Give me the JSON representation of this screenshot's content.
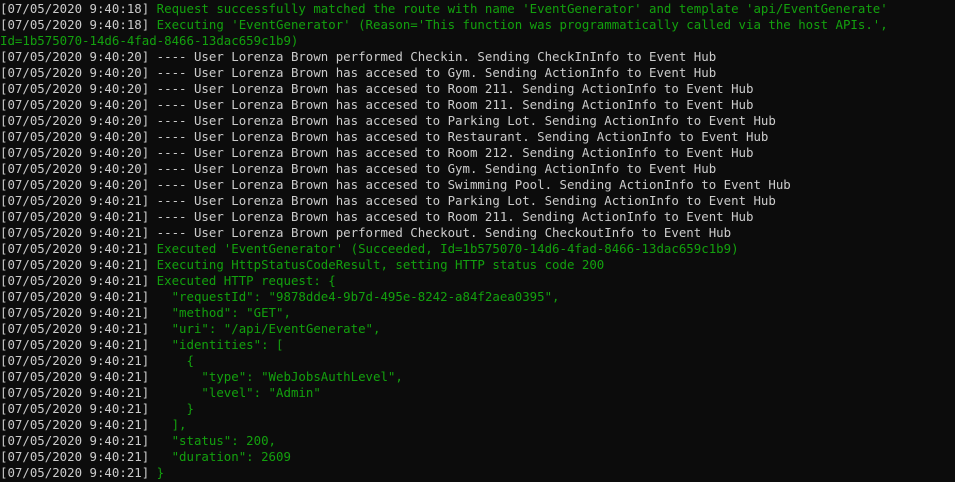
{
  "colors": {
    "background": "#0c0c0c",
    "timestamp": "#cccccc",
    "green": "#13a10e",
    "gray": "#cccccc"
  },
  "lines": [
    {
      "ts": "[07/05/2020 9:40:18]",
      "msg": " Request successfully matched the route with name 'EventGenerator' and template 'api/EventGenerate'",
      "c": "green"
    },
    {
      "ts": "[07/05/2020 9:40:18]",
      "msg": " Executing 'EventGenerator' (Reason='This function was programmatically called via the host APIs.',",
      "c": "green"
    },
    {
      "ts": "",
      "msg": "Id=1b575070-14d6-4fad-8466-13dac659c1b9)",
      "c": "green"
    },
    {
      "ts": "[07/05/2020 9:40:20]",
      "msg": " ---- User Lorenza Brown performed Checkin. Sending CheckInInfo to Event Hub",
      "c": "gray"
    },
    {
      "ts": "[07/05/2020 9:40:20]",
      "msg": " ---- User Lorenza Brown has accesed to Gym. Sending ActionInfo to Event Hub",
      "c": "gray"
    },
    {
      "ts": "[07/05/2020 9:40:20]",
      "msg": " ---- User Lorenza Brown has accesed to Room 211. Sending ActionInfo to Event Hub",
      "c": "gray"
    },
    {
      "ts": "[07/05/2020 9:40:20]",
      "msg": " ---- User Lorenza Brown has accesed to Room 211. Sending ActionInfo to Event Hub",
      "c": "gray"
    },
    {
      "ts": "[07/05/2020 9:40:20]",
      "msg": " ---- User Lorenza Brown has accesed to Parking Lot. Sending ActionInfo to Event Hub",
      "c": "gray"
    },
    {
      "ts": "[07/05/2020 9:40:20]",
      "msg": " ---- User Lorenza Brown has accesed to Restaurant. Sending ActionInfo to Event Hub",
      "c": "gray"
    },
    {
      "ts": "[07/05/2020 9:40:20]",
      "msg": " ---- User Lorenza Brown has accesed to Room 212. Sending ActionInfo to Event Hub",
      "c": "gray"
    },
    {
      "ts": "[07/05/2020 9:40:20]",
      "msg": " ---- User Lorenza Brown has accesed to Gym. Sending ActionInfo to Event Hub",
      "c": "gray"
    },
    {
      "ts": "[07/05/2020 9:40:20]",
      "msg": " ---- User Lorenza Brown has accesed to Swimming Pool. Sending ActionInfo to Event Hub",
      "c": "gray"
    },
    {
      "ts": "[07/05/2020 9:40:21]",
      "msg": " ---- User Lorenza Brown has accesed to Parking Lot. Sending ActionInfo to Event Hub",
      "c": "gray"
    },
    {
      "ts": "[07/05/2020 9:40:21]",
      "msg": " ---- User Lorenza Brown has accesed to Room 211. Sending ActionInfo to Event Hub",
      "c": "gray"
    },
    {
      "ts": "[07/05/2020 9:40:21]",
      "msg": " ---- User Lorenza Brown performed Checkout. Sending CheckoutInfo to Event Hub",
      "c": "gray"
    },
    {
      "ts": "[07/05/2020 9:40:21]",
      "msg": " Executed 'EventGenerator' (Succeeded, Id=1b575070-14d6-4fad-8466-13dac659c1b9)",
      "c": "green"
    },
    {
      "ts": "[07/05/2020 9:40:21]",
      "msg": " Executing HttpStatusCodeResult, setting HTTP status code 200",
      "c": "green"
    },
    {
      "ts": "[07/05/2020 9:40:21]",
      "msg": " Executed HTTP request: {",
      "c": "green"
    },
    {
      "ts": "[07/05/2020 9:40:21]",
      "msg": "   \"requestId\": \"9878dde4-9b7d-495e-8242-a84f2aea0395\",",
      "c": "green"
    },
    {
      "ts": "[07/05/2020 9:40:21]",
      "msg": "   \"method\": \"GET\",",
      "c": "green"
    },
    {
      "ts": "[07/05/2020 9:40:21]",
      "msg": "   \"uri\": \"/api/EventGenerate\",",
      "c": "green"
    },
    {
      "ts": "[07/05/2020 9:40:21]",
      "msg": "   \"identities\": [",
      "c": "green"
    },
    {
      "ts": "[07/05/2020 9:40:21]",
      "msg": "     {",
      "c": "green"
    },
    {
      "ts": "[07/05/2020 9:40:21]",
      "msg": "       \"type\": \"WebJobsAuthLevel\",",
      "c": "green"
    },
    {
      "ts": "[07/05/2020 9:40:21]",
      "msg": "       \"level\": \"Admin\"",
      "c": "green"
    },
    {
      "ts": "[07/05/2020 9:40:21]",
      "msg": "     }",
      "c": "green"
    },
    {
      "ts": "[07/05/2020 9:40:21]",
      "msg": "   ],",
      "c": "green"
    },
    {
      "ts": "[07/05/2020 9:40:21]",
      "msg": "   \"status\": 200,",
      "c": "green"
    },
    {
      "ts": "[07/05/2020 9:40:21]",
      "msg": "   \"duration\": 2609",
      "c": "green"
    },
    {
      "ts": "[07/05/2020 9:40:21]",
      "msg": " }",
      "c": "green"
    }
  ]
}
